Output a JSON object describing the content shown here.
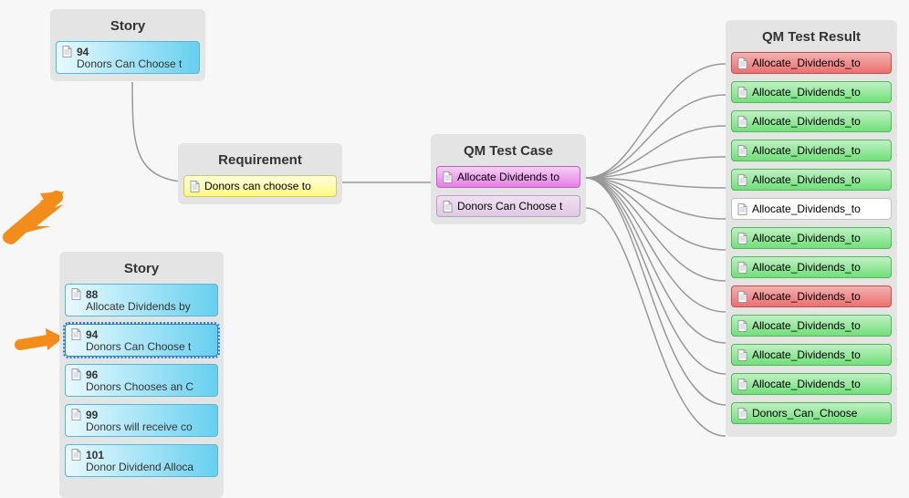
{
  "groups": {
    "story_top": {
      "title": "Story",
      "items": [
        {
          "id": "94",
          "text": "Donors Can Choose t"
        }
      ]
    },
    "story_bottom": {
      "title": "Story",
      "items": [
        {
          "id": "88",
          "text": "Allocate Dividends by"
        },
        {
          "id": "94",
          "text": "Donors Can Choose t",
          "selected": true
        },
        {
          "id": "96",
          "text": "Donors Chooses an C"
        },
        {
          "id": "99",
          "text": "Donors will receive co"
        },
        {
          "id": "101",
          "text": "Donor Dividend Alloca"
        }
      ]
    },
    "requirement": {
      "title": "Requirement",
      "items": [
        {
          "text": "Donors can choose to"
        }
      ]
    },
    "testcase": {
      "title": "QM Test Case",
      "items": [
        {
          "text": "Allocate Dividends to"
        },
        {
          "text": "Donors Can Choose t"
        }
      ]
    },
    "testresult": {
      "title": "QM Test Result",
      "items": [
        {
          "text": "Allocate_Dividends_to",
          "status": "red"
        },
        {
          "text": "Allocate_Dividends_to",
          "status": "green"
        },
        {
          "text": "Allocate_Dividends_to",
          "status": "green"
        },
        {
          "text": "Allocate_Dividends_to",
          "status": "green"
        },
        {
          "text": "Allocate_Dividends_to",
          "status": "green"
        },
        {
          "text": "Allocate_Dividends_to",
          "status": "white"
        },
        {
          "text": "Allocate_Dividends_to",
          "status": "green"
        },
        {
          "text": "Allocate_Dividends_to",
          "status": "green"
        },
        {
          "text": "Allocate_Dividends_to",
          "status": "red"
        },
        {
          "text": "Allocate_Dividends_to",
          "status": "green"
        },
        {
          "text": "Allocate_Dividends_to",
          "status": "green"
        },
        {
          "text": "Allocate_Dividends_to",
          "status": "green"
        },
        {
          "text": "Donors_Can_Choose",
          "status": "green"
        }
      ]
    }
  }
}
